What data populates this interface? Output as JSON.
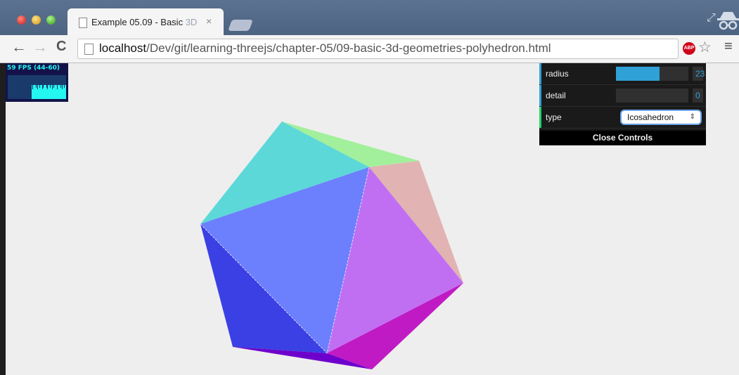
{
  "tab": {
    "title": "Example 05.09 - Basic ",
    "title_fade": "3D"
  },
  "toolbar": {
    "url_host": "localhost",
    "url_path": "/Dev/git/learning-threejs/chapter-05/09-basic-3d-geometries-polyhedron.html",
    "abp_label": "ABP"
  },
  "stats": {
    "label": "59 FPS (44-60)"
  },
  "controls": {
    "radius": {
      "label": "radius",
      "value": "23",
      "fill_fraction": 0.6,
      "accent": "#2fa1d6"
    },
    "detail": {
      "label": "detail",
      "value": "0",
      "fill_fraction": 0,
      "accent": "#2fa1d6"
    },
    "type": {
      "label": "type",
      "selected": "Icosahedron",
      "accent": "#1ed36f"
    },
    "close_label": "Close Controls"
  },
  "icons": {
    "back": "back-arrow-icon",
    "forward": "forward-arrow-icon",
    "reload": "reload-icon",
    "page": "page-icon",
    "star": "star-icon",
    "menu": "menu-icon",
    "fullscreen": "fullscreen-icon",
    "incognito": "incognito-icon"
  },
  "colors": {
    "face_top_left": "#5cd8d8",
    "face_top": "#a2f09c",
    "face_right_top": "#e2b3b3",
    "face_center": "#6c7ffc",
    "face_right": "#c16ff2",
    "face_left": "#3a40e4",
    "face_bottom_right": "#c01ac4",
    "face_bottom": "#6e00cc"
  }
}
